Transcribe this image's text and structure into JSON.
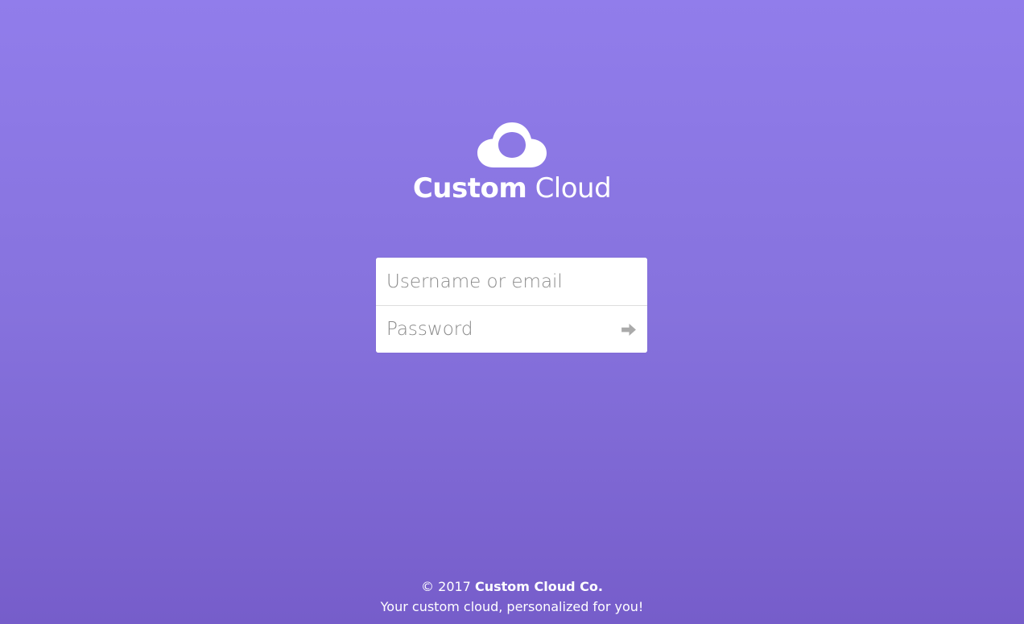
{
  "logo": {
    "icon": "cloud-icon",
    "name_bold": "Custom",
    "name_light": "Cloud"
  },
  "login": {
    "username_placeholder": "Username or email",
    "username_value": "",
    "password_placeholder": "Password",
    "password_value": "",
    "submit_icon": "arrow-right-icon"
  },
  "footer": {
    "copyright_prefix": "© 2017",
    "company": "Custom Cloud Co.",
    "tagline": "Your custom cloud, personalized for you!"
  },
  "colors": {
    "background_top": "#917deb",
    "background_bottom": "#765dca",
    "text": "#ffffff",
    "placeholder": "#8a8a8a",
    "icon_gray": "#aaaaaa"
  }
}
